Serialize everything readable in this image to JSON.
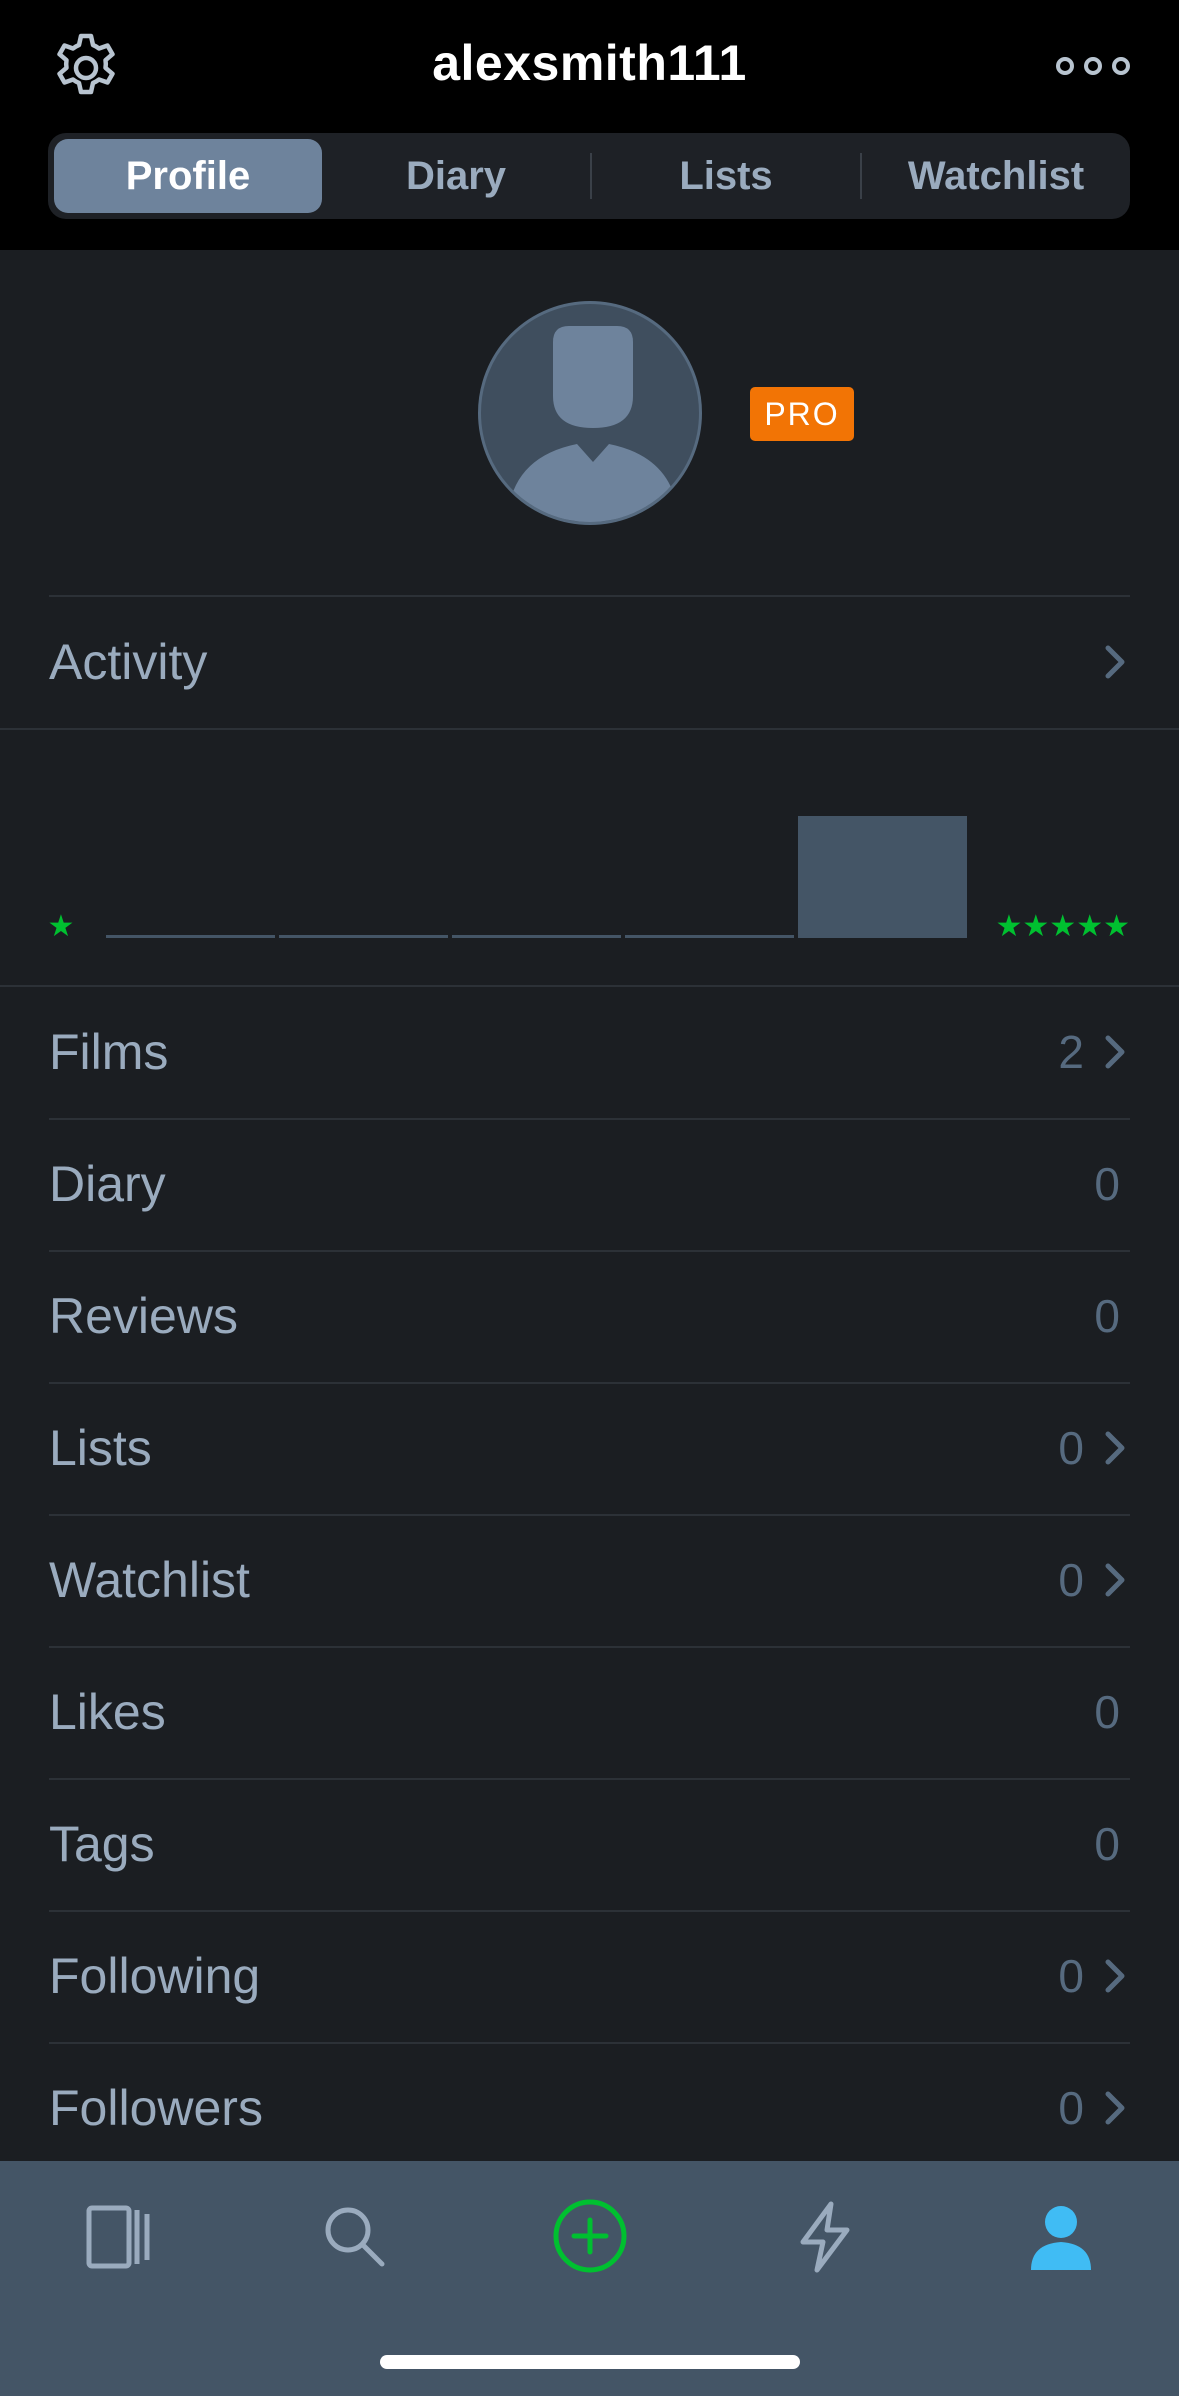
{
  "header": {
    "username": "alexsmith111",
    "settings_icon": "gear-icon",
    "more_icon": "more-icon"
  },
  "tabs": [
    {
      "label": "Profile",
      "active": true
    },
    {
      "label": "Diary",
      "active": false
    },
    {
      "label": "Lists",
      "active": false
    },
    {
      "label": "Watchlist",
      "active": false
    }
  ],
  "profile": {
    "badge": "PRO",
    "avatar_icon": "avatar-placeholder"
  },
  "activity": {
    "label": "Activity"
  },
  "ratings": {
    "chart_data": {
      "type": "bar",
      "categories": [
        "1",
        "2",
        "3",
        "4",
        "5"
      ],
      "values": [
        0,
        0,
        0,
        0,
        2
      ],
      "left_label": "★",
      "right_label": "★★★★★"
    },
    "star_color": "#00c030",
    "bar_color": "#445566"
  },
  "stats": [
    {
      "label": "Films",
      "count": "2",
      "chevron": true
    },
    {
      "label": "Diary",
      "count": "0",
      "chevron": false
    },
    {
      "label": "Reviews",
      "count": "0",
      "chevron": false
    },
    {
      "label": "Lists",
      "count": "0",
      "chevron": true
    },
    {
      "label": "Watchlist",
      "count": "0",
      "chevron": true
    },
    {
      "label": "Likes",
      "count": "0",
      "chevron": false
    },
    {
      "label": "Tags",
      "count": "0",
      "chevron": false
    },
    {
      "label": "Following",
      "count": "0",
      "chevron": true
    },
    {
      "label": "Followers",
      "count": "0",
      "chevron": true
    }
  ],
  "tabbar": [
    {
      "icon": "films-icon",
      "active": false
    },
    {
      "icon": "search-icon",
      "active": false
    },
    {
      "icon": "add-icon",
      "active": false
    },
    {
      "icon": "activity-bolt-icon",
      "active": false
    },
    {
      "icon": "profile-icon",
      "active": true
    }
  ],
  "colors": {
    "background": "#1b1e22",
    "accent_green": "#00c030",
    "pro_orange": "#f27405",
    "active_blue": "#40bcf4"
  }
}
